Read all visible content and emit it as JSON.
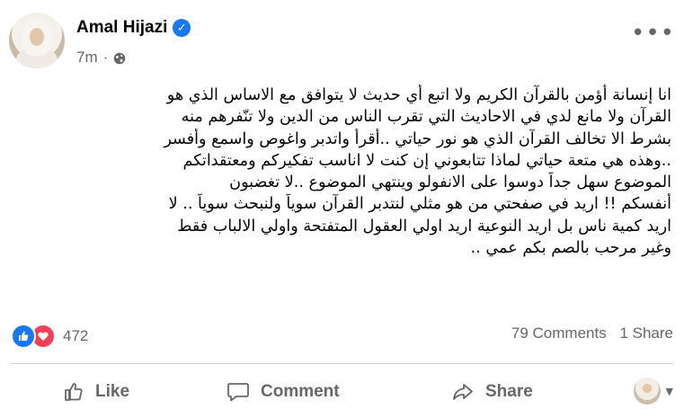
{
  "post": {
    "author": "Amal Hijazi",
    "verified_glyph": "✓",
    "timestamp": "7m",
    "meta_separator": "·",
    "privacy_icon": "globe-icon",
    "more_icon": "more-horizontal-icon",
    "more_glyph": "•••",
    "text_lines": [
      "انا إنسانة أؤمن بالقرآن الكريم ولا اتبع أي حديث لا يتوافق مع الاساس الذي هو",
      "القرآن ولا مانع لدي في الاحاديث التي تقرب الناس من الدين ولا تنّفرهم منه",
      "بشرط الا تخالف القرآن الذي هو نور حياتي  ..أقرأ واتدبر واغوص واسمع وأفسر",
      "..وهذه هي متعة حياتي لماذا تتابعوني  إن كنت لا اناسب تفكيركم ومعتقداتكم",
      "الموضوع سهل جداً  دوسوا على الانفولو وينتهي الموضوع ..لا تغضبون",
      "أنفسكم !! اريد في صفحتي من هو مثلي لنتدبر القرآن سوياً ولنبحث سوياً .. لا",
      "اريد كمية ناس بل اريد النوعية اريد اولي العقول المتفتحة  واولي الالباب فقط",
      "وغير مرحب بالصم بكم عمي .."
    ]
  },
  "stats": {
    "reaction_count": "472",
    "comments": "79 Comments",
    "shares": "1 Share"
  },
  "actions": {
    "like": "Like",
    "comment": "Comment",
    "share": "Share"
  },
  "colors": {
    "accent": "#1877f2",
    "love": "#f33e58",
    "secondary_text": "#65676b",
    "divider": "#ced0d4"
  }
}
